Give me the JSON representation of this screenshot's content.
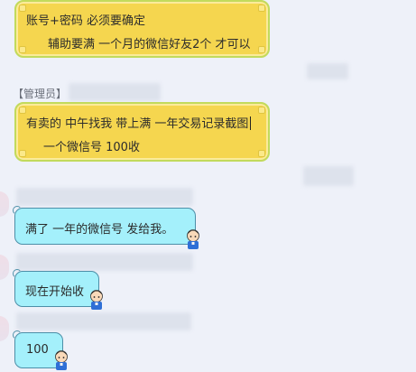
{
  "messages": [
    {
      "id": "m1",
      "lines": [
        "账号+密码  必须要确定",
        "辅助要满  一个月的微信好友2个  才可以"
      ]
    },
    {
      "sender_role": "【管理员】",
      "lines": [
        "有卖的  中午找我  带上满  一年交易记录截图",
        "一个微信号  100收"
      ]
    },
    {
      "id": "m3",
      "text": "满了  一年的微信号  发给我。"
    },
    {
      "id": "m4",
      "text": "现在开始收"
    },
    {
      "id": "m5",
      "text": "100"
    }
  ],
  "colors": {
    "background": "#eef1f9",
    "admin_bubble": "#f5d64f",
    "admin_border": "#c2da5c",
    "member_bubble": "#a4f0fb",
    "member_border": "#4d8fa8"
  }
}
